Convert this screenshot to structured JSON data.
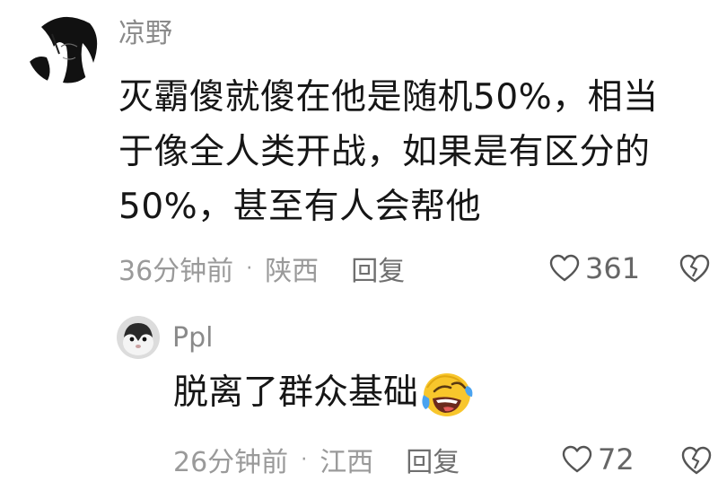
{
  "comment": {
    "username": "凉野",
    "avatar_icon": "anime-character-avatar-icon",
    "lines": [
      "灭霸傻就傻在他是随机50%，相当",
      "于像全人类开战，如果是有区分的",
      "50%，甚至有人会帮他"
    ],
    "time": "36分钟前",
    "location": "陕西",
    "reply_label": "回复",
    "likes": "361"
  },
  "reply": {
    "username": "Ppl",
    "avatar_icon": "guinea-pig-avatar-icon",
    "text": "脱离了群众基础",
    "emoji": "rolling-laughing-emoji-icon",
    "time": "26分钟前",
    "location": "江西",
    "reply_label": "回复",
    "likes": "72"
  },
  "colors": {
    "username": "#8a8a8a",
    "text": "#161616",
    "meta": "#9a9a9a",
    "emoji_yellow": "#f8c62c",
    "emoji_tear_blue": "#4aa3f0"
  }
}
